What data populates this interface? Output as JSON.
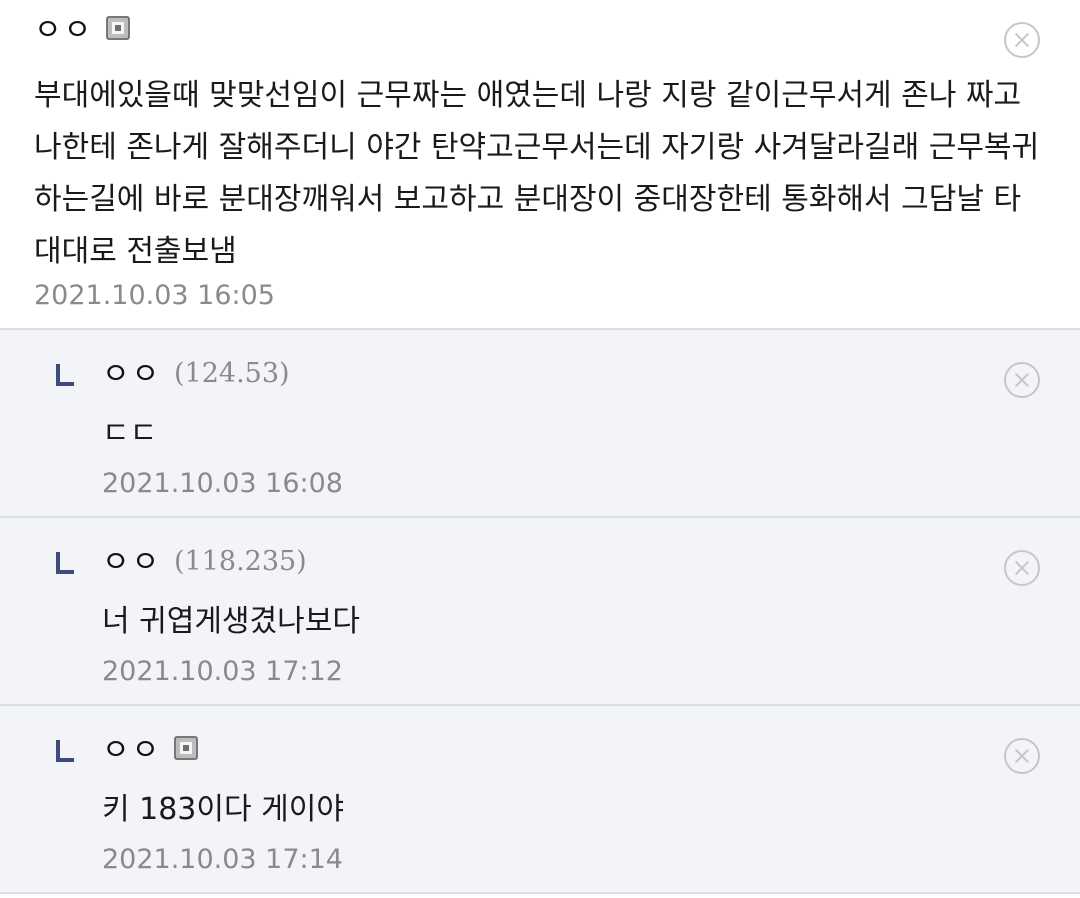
{
  "comments": [
    {
      "nickname": "ㅇㅇ",
      "ip": "",
      "badge_icon": "member-badge-icon",
      "text": "부대에있을때 맞맞선임이 근무짜는 애였는데 나랑 지랑 같이근무서게 존나 짜고 나한테 존나게 잘해주더니 야간 탄약고근무서는데 자기랑 사겨달라길래 근무복귀하는길에 바로 분대장깨워서 보고하고 분대장이 중대장한테 통화해서 그담날 타대대로 전출보냄",
      "date": "2021.10.03 16:05"
    },
    {
      "nickname": "ㅇㅇ",
      "ip": "(124.53)",
      "text": "ㄷㄷ",
      "date": "2021.10.03 16:08"
    },
    {
      "nickname": "ㅇㅇ",
      "ip": "(118.235)",
      "text": "너 귀엽게생겼나보다",
      "date": "2021.10.03 17:12"
    },
    {
      "nickname": "ㅇㅇ",
      "ip": "",
      "badge_icon": "member-badge-icon",
      "text": "키 183이다 게이야",
      "date": "2021.10.03 17:14"
    }
  ],
  "icons": {
    "reply": "reply-arrow-icon",
    "delete": "delete-circle-x-icon"
  },
  "colors": {
    "reply_background": "#f3f4f8",
    "divider": "#dcdee6",
    "meta_text": "#8a8a8a",
    "reply_arrow": "#3c4a7c"
  }
}
